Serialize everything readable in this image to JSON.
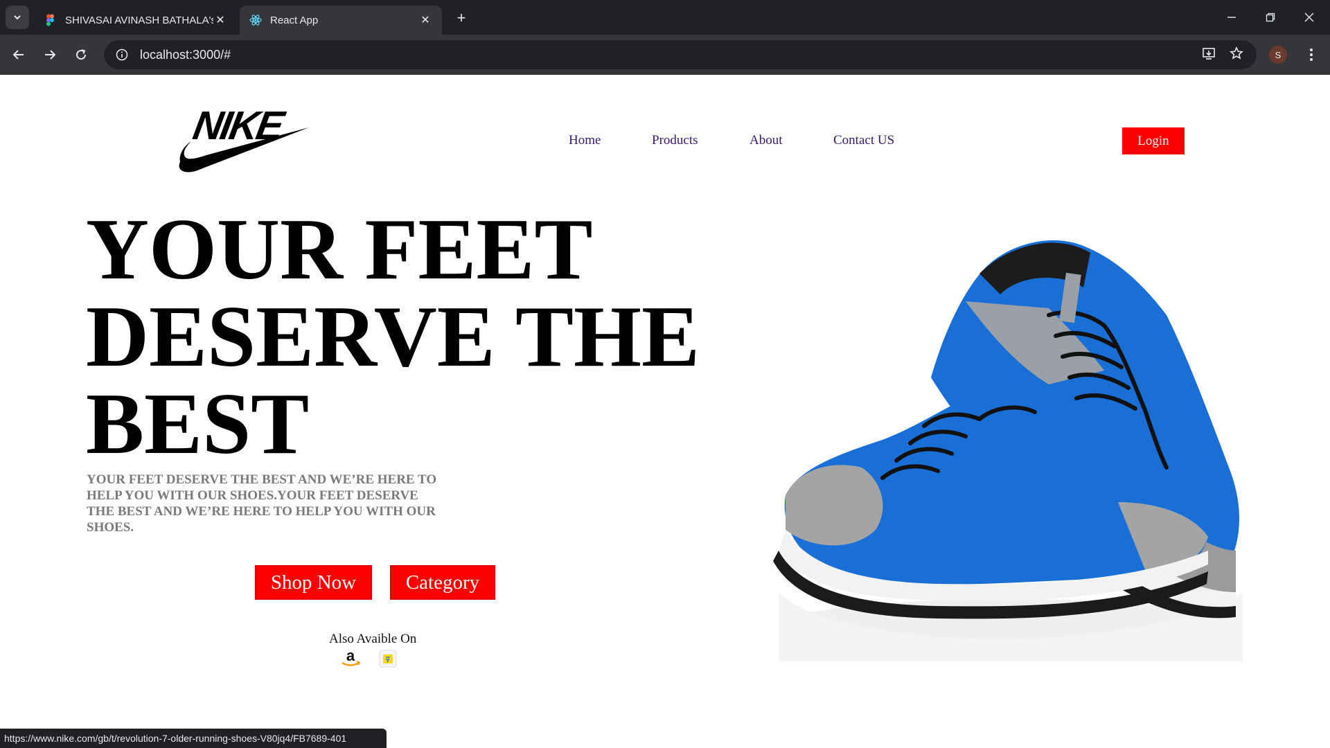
{
  "browser": {
    "tabs": [
      {
        "title": "SHIVASAI AVINASH BATHALA's",
        "icon": "figma-icon",
        "active": false
      },
      {
        "title": "React App",
        "icon": "react-icon",
        "active": true
      }
    ],
    "url": "localhost:3000/#",
    "profile_initial": "S",
    "status_url": "https://www.nike.com/gb/t/revolution-7-older-running-shoes-V80jq4/FB7689-401"
  },
  "header": {
    "brand": "NIKE",
    "nav": [
      "Home",
      "Products",
      "About",
      "Contact US"
    ],
    "login_label": "Login"
  },
  "hero": {
    "headline_lines": [
      "YOUR FEET",
      "DESERVE THE",
      "BEST"
    ],
    "subtext": "YOUR FEET DESERVE THE BEST AND WE’RE HERE TO HELP YOU WITH OUR SHOES.YOUR FEET DESERVE THE BEST AND WE’RE HERE TO HELP YOU WITH OUR SHOES.",
    "shop_now_label": "Shop Now",
    "category_label": "Category",
    "also_available": "Also Avaible On",
    "stores": [
      "amazon-icon",
      "flipkart-icon"
    ]
  },
  "colors": {
    "accent": "#ff0000",
    "nav_text": "#3a1a6b",
    "subtext": "#7a7a7a",
    "chrome_dark": "#1f2124",
    "chrome_toolbar": "#35363a",
    "shoe_blue": "#1a6fd6"
  }
}
